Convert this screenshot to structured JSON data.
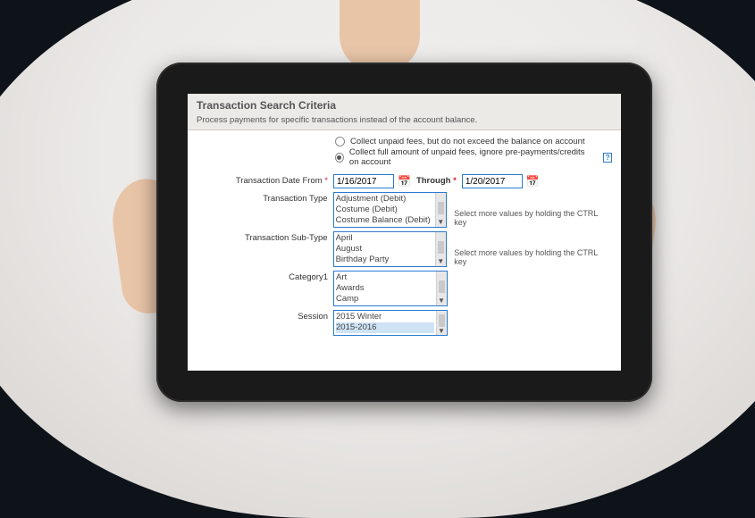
{
  "panel": {
    "title": "Transaction Search Criteria",
    "subtext": "Process payments for specific transactions instead of the account balance."
  },
  "collect": {
    "opt1": "Collect unpaid fees, but do not exceed the balance on account",
    "opt2": "Collect full amount of unpaid fees, ignore pre-payments/credits on account"
  },
  "labels": {
    "date_from": "Transaction Date From",
    "through": "Through",
    "type": "Transaction Type",
    "subtype": "Transaction Sub-Type",
    "category1": "Category1",
    "session": "Session"
  },
  "date": {
    "from": "1/16/2017",
    "to": "1/20/2017"
  },
  "type_options": [
    "Adjustment (Debit)",
    "Costume (Debit)",
    "Costume Balance (Debit)"
  ],
  "subtype_options": [
    "April",
    "August",
    "Birthday Party"
  ],
  "category1_options": [
    "Art",
    "Awards",
    "Camp"
  ],
  "session_options": [
    "2015 Winter",
    "2015-2016"
  ],
  "hint": "Select more values by holding the CTRL key"
}
